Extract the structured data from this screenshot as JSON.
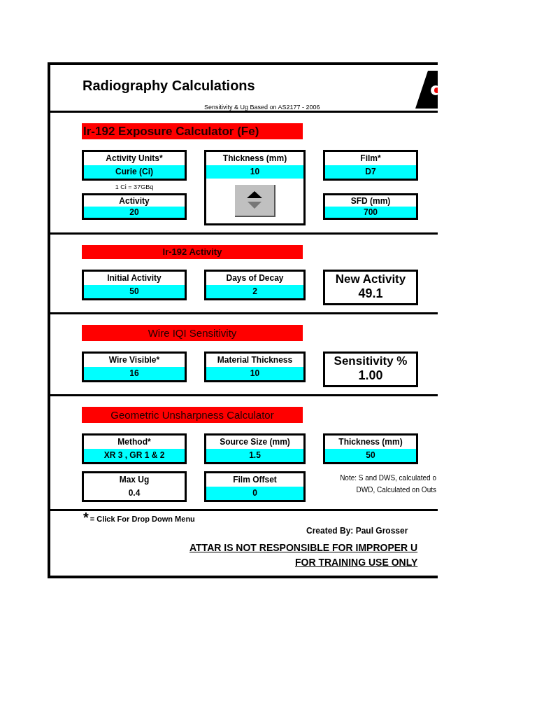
{
  "title": "Radiography Calculations",
  "subtitle": "Sensitivity & Ug Based on AS2177 - 2006",
  "sections": [
    {
      "heading": "Ir-192 Exposure Calculator (Fe)",
      "large": true,
      "columns": [
        [
          {
            "kind": "field",
            "label": "Activity Units*",
            "value": "Curie (Ci)",
            "input": true
          },
          {
            "kind": "note",
            "text": "1 Ci = 37GBq"
          },
          {
            "kind": "field",
            "label": "Activity",
            "value": "20",
            "input": true
          }
        ],
        [
          {
            "kind": "spinfield",
            "label": "Thickness (mm)",
            "value": "10",
            "input": true
          }
        ],
        [
          {
            "kind": "field",
            "label": "Film*",
            "value": "D7",
            "input": true
          },
          {
            "kind": "gap"
          },
          {
            "kind": "field",
            "label": "SFD (mm)",
            "value": "700",
            "input": true
          }
        ]
      ]
    },
    {
      "heading": "Ir-192 Activity",
      "large": false,
      "columns": [
        [
          {
            "kind": "field",
            "label": "Initial Activity",
            "value": "50",
            "input": true
          }
        ],
        [
          {
            "kind": "field",
            "label": "Days of Decay",
            "value": "2",
            "input": true
          }
        ],
        [
          {
            "kind": "result",
            "label": "New Activity",
            "value": "49.1"
          }
        ]
      ]
    },
    {
      "heading": "Wire IQI Sensitivity",
      "large": false,
      "columns": [
        [
          {
            "kind": "field",
            "label": "Wire Visible*",
            "value": "16",
            "input": true
          }
        ],
        [
          {
            "kind": "field",
            "label": "Material Thickness",
            "value": "10",
            "input": true
          }
        ],
        [
          {
            "kind": "result",
            "label": "Sensitivity %",
            "value": "1.00"
          }
        ]
      ]
    },
    {
      "heading": "Geometric Unsharpness Calculator",
      "large": false,
      "columns": [
        [
          {
            "kind": "field",
            "label": "Method*",
            "value": "XR 3 , GR 1 & 2",
            "input": true
          },
          {
            "kind": "field",
            "label": "Max Ug",
            "value": "0.4",
            "input": false
          }
        ],
        [
          {
            "kind": "field",
            "label": "Source Size (mm)",
            "value": "1.5",
            "input": true
          },
          {
            "kind": "field",
            "label": "Film Offset",
            "value": "0",
            "input": true
          }
        ],
        [
          {
            "kind": "field",
            "label": "Thickness (mm)",
            "value": "50",
            "input": true
          },
          {
            "kind": "notes",
            "lines": [
              "Note: S and DWS, calculated o",
              "DWD, Calculated on Outs"
            ]
          }
        ]
      ]
    }
  ],
  "footer": {
    "mark": "*",
    "legend": "= Click For Drop Down Menu",
    "credit": "Created By: Paul Grosser",
    "disclaimer": [
      "ATTAR IS NOT RESPONSIBLE FOR IMPROPER U",
      "FOR TRAINING USE ONLY"
    ]
  }
}
